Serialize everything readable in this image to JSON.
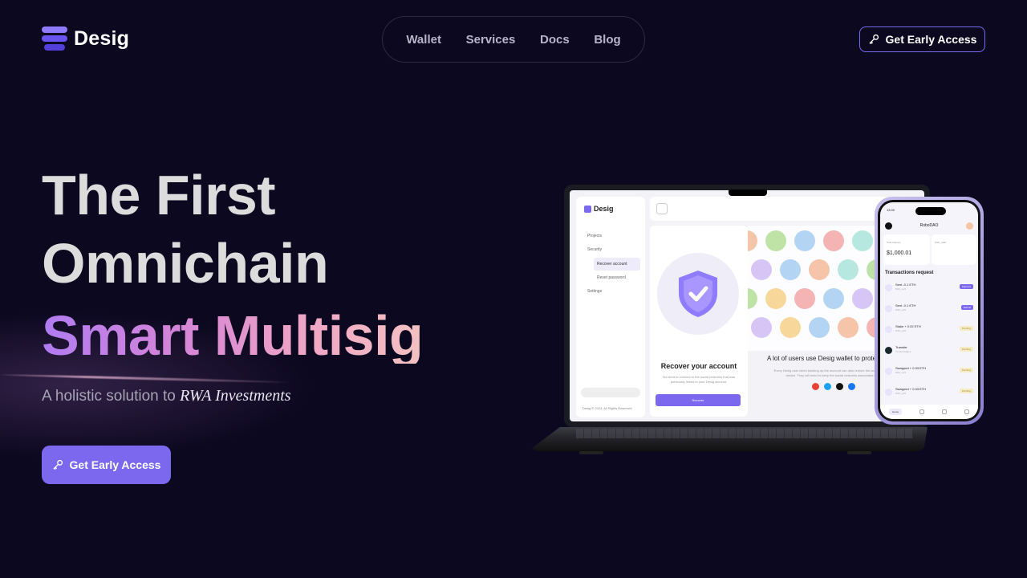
{
  "brand": {
    "name": "Desig"
  },
  "nav": {
    "items": [
      "Wallet",
      "Services",
      "Docs",
      "Blog"
    ]
  },
  "header": {
    "cta_label": "Get Early Access"
  },
  "hero": {
    "line1": "The First",
    "line2": "Omnichain",
    "line3": "Smart Multisig",
    "subtitle_prefix": "A holistic solution to ",
    "subtitle_emphasis": "RWA Investments",
    "cta_label": "Get Early Access"
  },
  "mockup": {
    "laptop": {
      "brand": "Desig",
      "sidebar": [
        "Projects",
        "Security",
        "Recover account",
        "Reset password",
        "Settings"
      ],
      "footer": "Desig © 2023. All Rights Reserved",
      "recover_title": "Recover your account",
      "recover_desc": "No need to connect to the social networks that was previously linked to your Desig account.",
      "recover_button": "Recover",
      "users_title": "A lot of users use Desig wallet to protect",
      "users_desc": "Every Desig user when backing up the account can also restore the account or import via a new device. They will need to keep the social networks associated with the account."
    },
    "phone": {
      "time": "13:00",
      "org": "RoboDAO",
      "balance_label": "Total balance",
      "balance": "$1,000.01",
      "sig_label": "DSG_addr",
      "section_title": "Transactions request",
      "rows": [
        {
          "title": "Sent -0.1 ETH",
          "sub": "DSG_ax9",
          "tag": "Approve",
          "time": "1 min ago"
        },
        {
          "title": "Sent -0.1 ETH",
          "sub": "DSG_ax9",
          "tag": "Submit",
          "time": "4 min ago"
        },
        {
          "title": "Stake + 0.02 ETH",
          "sub": "DSG_ax9",
          "tag": "Pending",
          "time": "4 min ago"
        },
        {
          "title": "Transfer",
          "sub": "Tomas Dragon",
          "tag": "Pending",
          "time": "15 min ago"
        },
        {
          "title": "Swapped + 0.03 ETH",
          "sub": "DSG_ax9",
          "tag": "Pending",
          "time": "30 min ago"
        },
        {
          "title": "Swapped + 0.03 ETH",
          "sub": "DSG_ax9",
          "tag": "Pending",
          "time": "1h ago"
        }
      ],
      "nav_home": "Home"
    }
  },
  "colors": {
    "background": "#0c0820",
    "accent": "#7b68ee",
    "gradient_start": "#b07cf2",
    "gradient_end": "#f2c2c2"
  }
}
